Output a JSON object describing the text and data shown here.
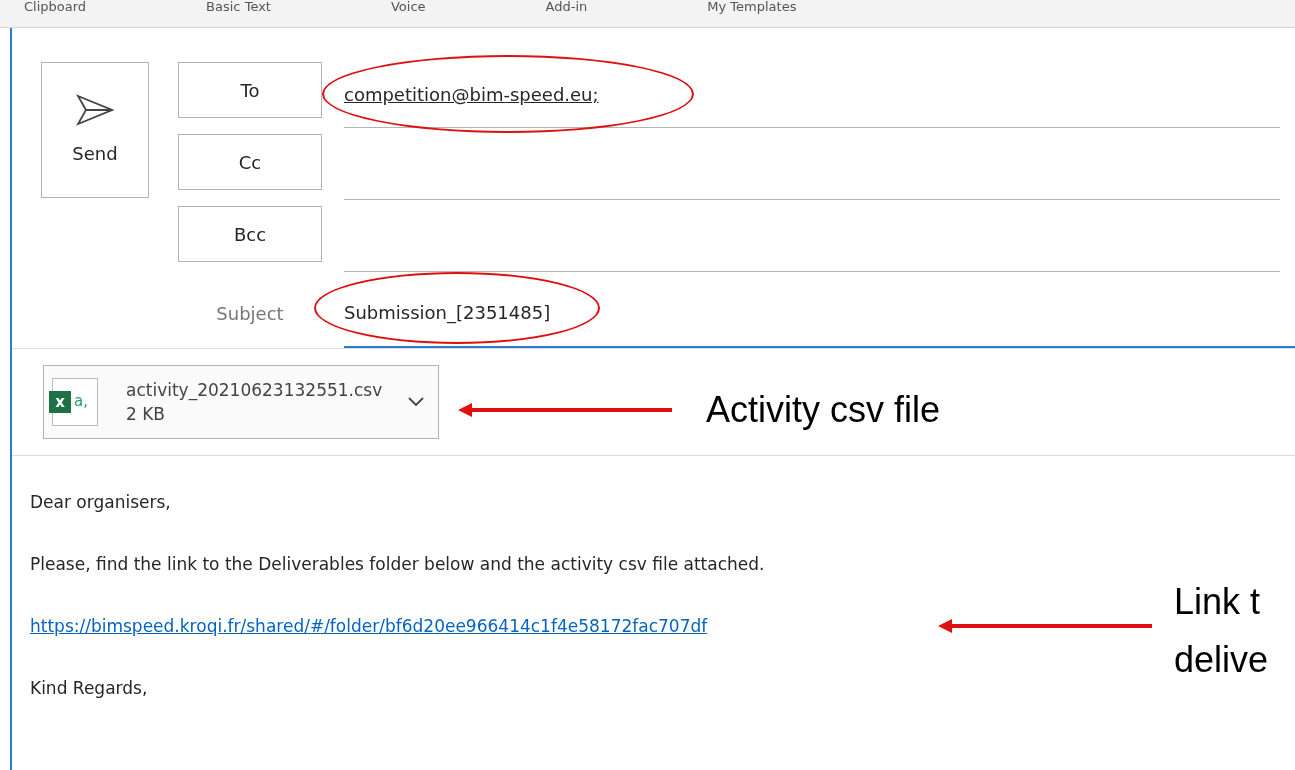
{
  "ribbon": {
    "groups": [
      "Clipboard",
      "Basic Text",
      "Voice",
      "Add-in",
      "My Templates"
    ]
  },
  "compose": {
    "send": "Send",
    "fields": [
      {
        "label": "To",
        "value": "competition@bim-speed.eu;"
      },
      {
        "label": "Cc"
      },
      {
        "label": "Bcc"
      }
    ],
    "subject": {
      "label": "Subject",
      "value": "Submission_[2351485]"
    },
    "attachment": {
      "name": "activity_20210623132551.csv",
      "size": "2 KB",
      "icon_text": "x",
      "icon_text_2": "a,"
    }
  },
  "body": [
    {
      "kind": "text",
      "text": "Dear organisers,"
    },
    {
      "kind": "text",
      "text": "Please, find the link to the Deliverables folder below and the activity csv file attached."
    },
    {
      "kind": "link",
      "text": "https://bimspeed.kroqi.fr/shared/#/folder/bf6d20ee966414c1f4e58172fac707df"
    },
    {
      "kind": "text",
      "text": "Kind Regards,"
    }
  ],
  "annotations": [
    {
      "text": "Activity csv file"
    },
    {
      "text": "Link t"
    },
    {
      "text": "delive"
    }
  ]
}
